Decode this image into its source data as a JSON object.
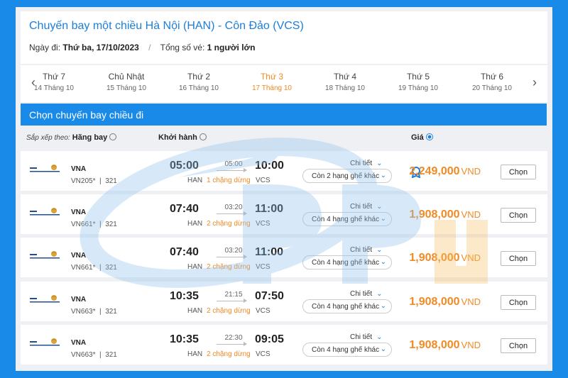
{
  "header": {
    "title": "Chuyến bay một chiều Hà Nội (HAN) - Côn Đảo (VCS)",
    "date_label": "Ngày đi:",
    "date_value": "Thứ ba, 17/10/2023",
    "tickets_label": "Tổng số vé:",
    "tickets_value": "1 người lớn"
  },
  "date_strip": {
    "days": [
      {
        "name": "Thứ 7",
        "date": "14 Tháng 10",
        "active": false
      },
      {
        "name": "Chủ Nhật",
        "date": "15 Tháng 10",
        "active": false
      },
      {
        "name": "Thứ 2",
        "date": "16 Tháng 10",
        "active": false
      },
      {
        "name": "Thứ 3",
        "date": "17 Tháng 10",
        "active": true
      },
      {
        "name": "Thứ 4",
        "date": "18 Tháng 10",
        "active": false
      },
      {
        "name": "Thứ 5",
        "date": "19 Tháng 10",
        "active": false
      },
      {
        "name": "Thứ 6",
        "date": "20 Tháng 10",
        "active": false
      }
    ]
  },
  "section_title": "Chọn chuyến bay chiều đi",
  "sort": {
    "label": "Sắp xếp theo:",
    "by_airline": "Hãng bay",
    "by_departure": "Khởi hành",
    "by_price": "Giá",
    "selected": "Giá"
  },
  "flights": [
    {
      "airline": "VNA",
      "code": "VN205*",
      "aircraft": "321",
      "dep_time": "05:00",
      "dep_code": "HAN",
      "duration": "05:00",
      "stops": "1 chặng dừng",
      "arr_time": "10:00",
      "arr_code": "VCS",
      "detail": "Chi tiết",
      "classes": "Còn 2 hạng ghế khác",
      "price": "2,249,000",
      "currency": "VND",
      "best": true,
      "choose": "Chọn"
    },
    {
      "airline": "VNA",
      "code": "VN661*",
      "aircraft": "321",
      "dep_time": "07:40",
      "dep_code": "HAN",
      "duration": "03:20",
      "stops": "2 chặng dừng",
      "arr_time": "11:00",
      "arr_code": "VCS",
      "detail": "Chi tiết",
      "classes": "Còn 4 hạng ghế khác",
      "price": "1,908,000",
      "currency": "VND",
      "best": false,
      "choose": "Chọn"
    },
    {
      "airline": "VNA",
      "code": "VN661*",
      "aircraft": "321",
      "dep_time": "07:40",
      "dep_code": "HAN",
      "duration": "03:20",
      "stops": "2 chặng dừng",
      "arr_time": "11:00",
      "arr_code": "VCS",
      "detail": "Chi tiết",
      "classes": "Còn 4 hạng ghế khác",
      "price": "1,908,000",
      "currency": "VND",
      "best": false,
      "choose": "Chọn"
    },
    {
      "airline": "VNA",
      "code": "VN663*",
      "aircraft": "321",
      "dep_time": "10:35",
      "dep_code": "HAN",
      "duration": "21:15",
      "stops": "2 chặng dừng",
      "arr_time": "07:50",
      "arr_code": "VCS",
      "detail": "Chi tiết",
      "classes": "Còn 4 hạng ghế khác",
      "price": "1,908,000",
      "currency": "VND",
      "best": false,
      "choose": "Chọn"
    },
    {
      "airline": "VNA",
      "code": "VN663*",
      "aircraft": "321",
      "dep_time": "10:35",
      "dep_code": "HAN",
      "duration": "22:30",
      "stops": "2 chặng dừng",
      "arr_time": "09:05",
      "arr_code": "VCS",
      "detail": "Chi tiết",
      "classes": "Còn 4 hạng ghế khác",
      "price": "1,908,000",
      "currency": "VND",
      "best": false,
      "choose": "Chọn"
    }
  ],
  "colors": {
    "accent_blue": "#1a8ae8",
    "title_blue": "#1d7ed8",
    "price_orange": "#f08a24"
  },
  "icons": {
    "prev": "chevron-left-icon",
    "next": "chevron-right-icon",
    "expand": "chevron-down-icon",
    "best_price": "medal-icon",
    "airline_logo": "vietnam-airlines-logo"
  }
}
